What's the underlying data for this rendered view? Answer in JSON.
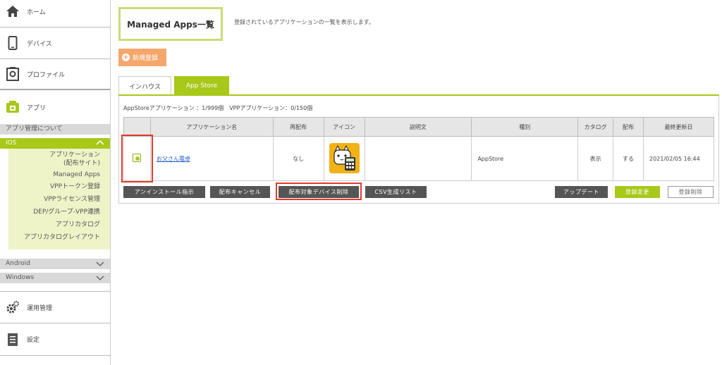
{
  "sidebar": {
    "home": "ホーム",
    "device": "デバイス",
    "profile": "プロファイル",
    "app": "アプリ",
    "about": "アプリ管理について",
    "ios": "iOS",
    "ios_items": [
      {
        "label": "アプリケーション"
      },
      {
        "label": "(配布サイト)"
      },
      {
        "label": "Managed Apps"
      },
      {
        "label": "VPPトークン登録"
      },
      {
        "label": "VPPライセンス管理"
      },
      {
        "label": "DEP/グループ-VPP連携"
      },
      {
        "label": "アプリカタログ"
      },
      {
        "label": "アプリカタログレイアウト"
      }
    ],
    "android": "Android",
    "windows": "Windows",
    "operations": "運用管理",
    "settings": "設定"
  },
  "main": {
    "title": "Managed Apps一覧",
    "description": "登録されているアプリケーションの一覧を表示します。",
    "new_button": "新規登録",
    "tabs": [
      {
        "label": "インハウス"
      },
      {
        "label": "App Store"
      }
    ],
    "counts": "AppStoreアプリケーション ：1/999個　VPPアプリケーション：0/150個",
    "table": {
      "headers": [
        "アプリケーション名",
        "再配布",
        "アイコン",
        "説明文",
        "種別",
        "カタログ",
        "配布",
        "最終更新日"
      ],
      "rows": [
        {
          "name": "お父さん電卓",
          "redistribute": "なし",
          "description": "",
          "type": "AppStore",
          "catalog": "表示",
          "distribute": "する",
          "updated": "2021/02/05 16:44"
        }
      ]
    },
    "actions": {
      "uninstall": "アンインストール指示",
      "cancel_dist": "配布キャンセル",
      "remove_devices": "配布対象デバイス削除",
      "csv": "CSV生成リスト",
      "update": "アップデート",
      "change_reg": "登録変更",
      "delete_reg": "登録削除"
    }
  },
  "colors": {
    "accent": "#a8c81a",
    "new_button": "#f5a66c",
    "highlight": "#e23b2a"
  }
}
